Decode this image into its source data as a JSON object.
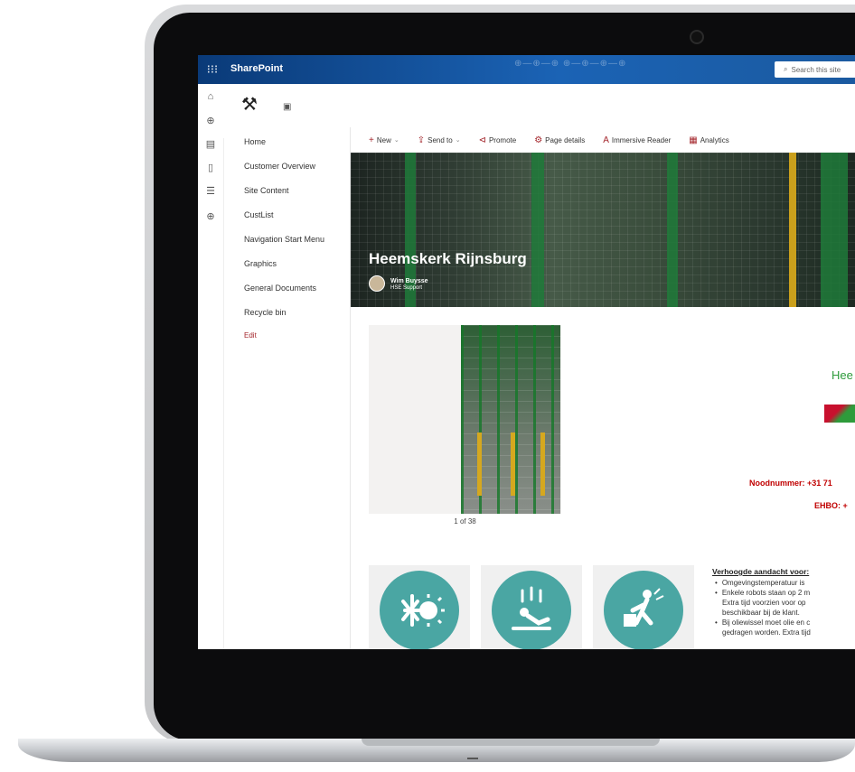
{
  "suite": {
    "waffle": "⁝⁝⁝",
    "brand": "SharePoint",
    "search_placeholder": "Search this site"
  },
  "nav": {
    "items": [
      "Home",
      "Customer Overview",
      "Site Content",
      "CustList",
      "Navigation Start Menu",
      "Graphics",
      "General Documents",
      "Recycle bin"
    ],
    "edit_label": "Edit"
  },
  "commands": [
    {
      "label": "New",
      "icon": "+",
      "chevron": true
    },
    {
      "label": "Send to",
      "icon": "⇪",
      "chevron": true
    },
    {
      "label": "Promote",
      "icon": "⊲",
      "chevron": false
    },
    {
      "label": "Page details",
      "icon": "⚙",
      "chevron": false
    },
    {
      "label": "Immersive Reader",
      "icon": "A",
      "chevron": false
    },
    {
      "label": "Analytics",
      "icon": "▦",
      "chevron": false
    }
  ],
  "hero": {
    "title": "Heemskerk Rijnsburg",
    "author_name": "Wim Buysse",
    "author_role": "HSE Support"
  },
  "gallery": {
    "counter": "1 of 38"
  },
  "panel": {
    "brand_partial": "Hee",
    "emergency": "Noodnummer: +31 71",
    "ehbo": "EHBO: +"
  },
  "attention": {
    "title": "Verhoogde aandacht voor:",
    "items": [
      [
        "Omgevingstemperatuur is"
      ],
      [
        "Enkele robots staan op 2 m",
        "Extra tijd voorzien voor op",
        "beschikbaar bij de klant."
      ],
      [
        "Bij oliewissel moet olie en c",
        "gedragen worden. Extra tijd"
      ]
    ]
  },
  "icons": [
    "temperature-hazard-icon",
    "falling-hazard-icon",
    "lifting-hazard-icon"
  ],
  "colors": {
    "accent": "#a4262c",
    "teal": "#4aa6a3",
    "emergency_red": "#c00000",
    "suitebar": "#1b63b5"
  }
}
